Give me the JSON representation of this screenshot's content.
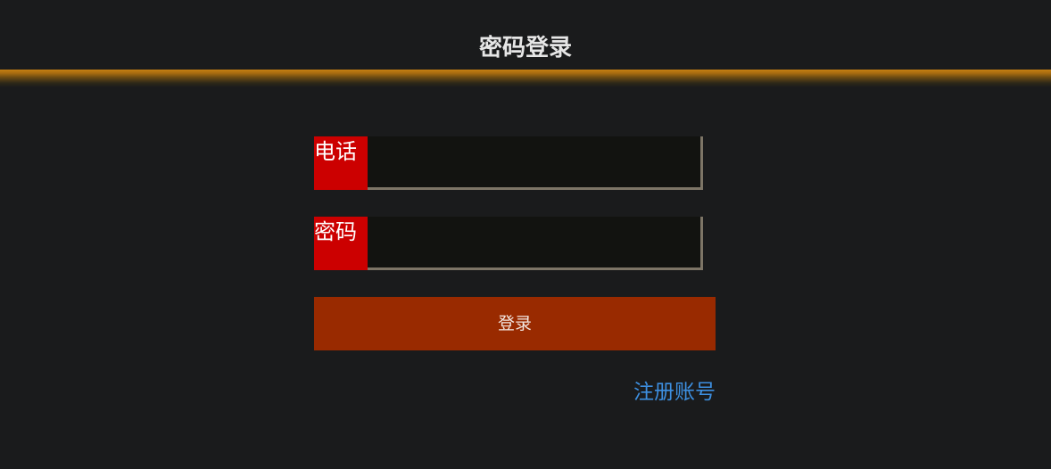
{
  "header": {
    "title": "密码登录",
    "accent_color": "#c47f12"
  },
  "form": {
    "phone": {
      "label": "电话",
      "value": ""
    },
    "password": {
      "label": "密码",
      "value": ""
    },
    "login_label": "登录",
    "register_label": "注册账号"
  },
  "colors": {
    "background": "#1a1b1c",
    "label_bg": "#cc0000",
    "button_bg": "#992a00",
    "link": "#3d8fe0"
  }
}
